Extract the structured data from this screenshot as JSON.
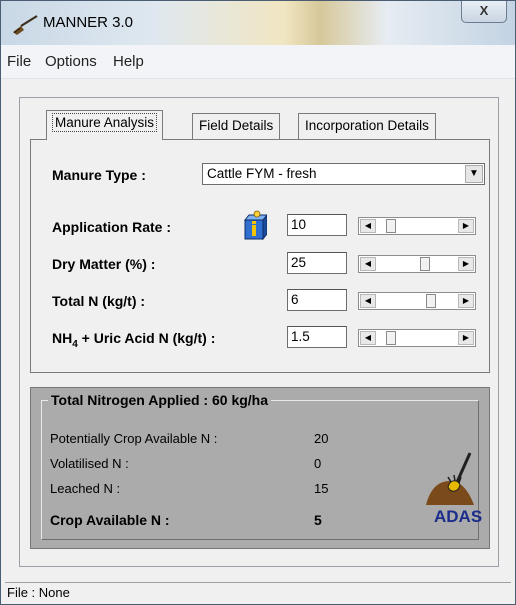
{
  "window": {
    "title": "MANNER 3.0",
    "close_label": "X"
  },
  "menu": {
    "items": [
      "File",
      "Options",
      "Help"
    ]
  },
  "tabs": [
    "Manure Analysis",
    "Field Details",
    "Incorporation Details"
  ],
  "manure": {
    "type_label": "Manure Type :",
    "type_value": "Cattle FYM - fresh",
    "fields": [
      {
        "label": "Application Rate :",
        "value": "10",
        "slider": 0.12
      },
      {
        "label": "Dry Matter (%) :",
        "value": "25",
        "slider": 0.5
      },
      {
        "label": "Total N (kg/t) :",
        "value": "6",
        "slider": 0.55
      },
      {
        "label_main": "NH",
        "label_sub": "4",
        "label_rest": " + Uric Acid N (kg/t) :",
        "value": "1.5",
        "slider": 0.12
      }
    ]
  },
  "results": {
    "heading": "Total Nitrogen Applied : 60 kg/ha",
    "rows": [
      {
        "label": "Potentially Crop Available N :",
        "value": "20"
      },
      {
        "label": "Volatilised N :",
        "value": "0"
      },
      {
        "label": "Leached N :",
        "value": "15"
      }
    ],
    "crop_label": "Crop Available N :",
    "crop_value": "5",
    "logo_text": "ADAS"
  },
  "status": {
    "text": "File : None"
  },
  "icons": {
    "app": "spade-icon",
    "info": "info-icon",
    "logo": "adas-logo-icon"
  },
  "colors": {
    "results_bg": "#ababab",
    "logo_blue": "#1c2d8c",
    "info_blue": "#2f6fd0"
  }
}
